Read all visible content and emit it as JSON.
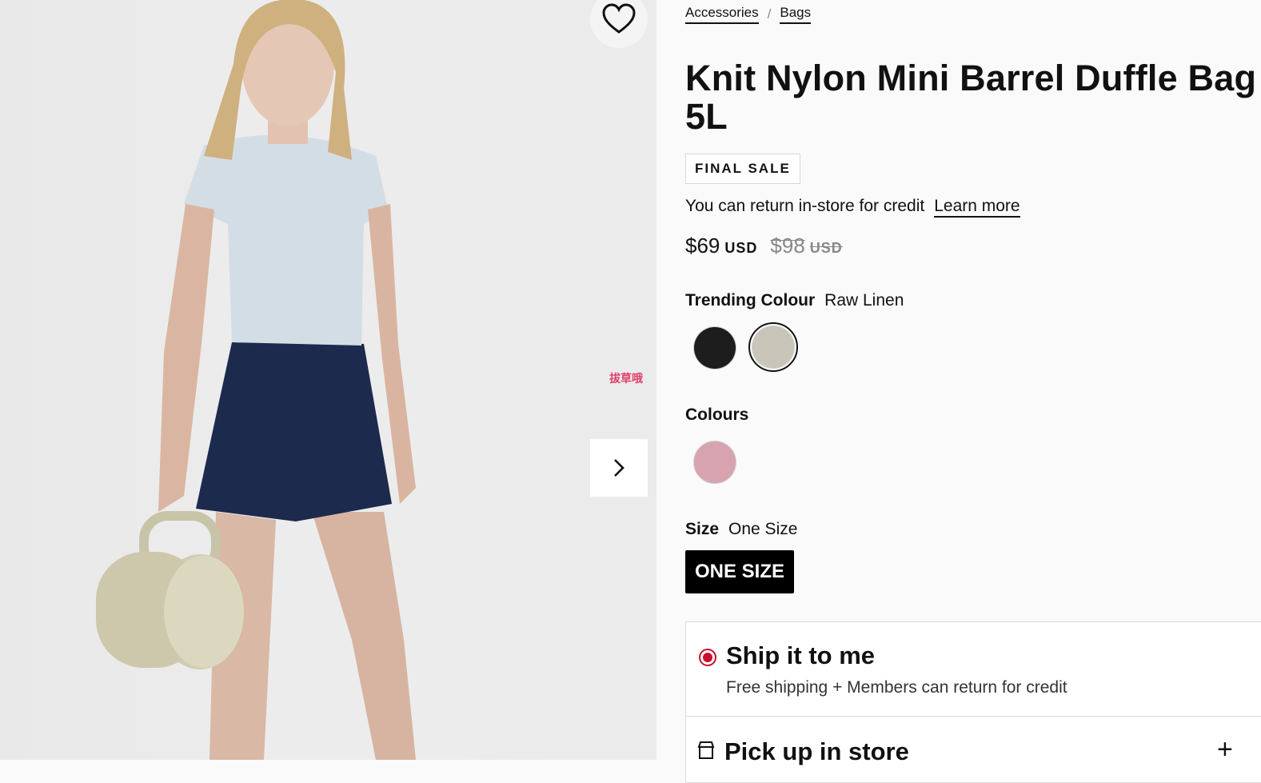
{
  "gallery": {
    "watermark": "拔草哦"
  },
  "breadcrumb": {
    "items": [
      "Accessories",
      "Bags"
    ],
    "separator": "/"
  },
  "product": {
    "title": "Knit Nylon Mini Barrel Duffle Bag 5L",
    "badge": "FINAL SALE",
    "return_text": "You can return in-store for credit",
    "learn_more": "Learn more",
    "price": "$69",
    "currency": "USD",
    "old_price": "$98",
    "old_currency": "USD"
  },
  "trending": {
    "label": "Trending Colour",
    "selected": "Raw Linen",
    "swatches": [
      {
        "name": "black",
        "color": "#1d1d1d"
      },
      {
        "name": "raw-linen",
        "color": "#c9c5b8"
      }
    ]
  },
  "colours": {
    "label": "Colours",
    "swatches": [
      {
        "name": "pink",
        "color": "#d7a3ae"
      }
    ]
  },
  "size": {
    "label": "Size",
    "selected": "One Size",
    "button": "ONE SIZE"
  },
  "shipping": {
    "ship_title": "Ship it to me",
    "ship_sub": "Free shipping + Members can return for credit",
    "pickup_title": "Pick up in store",
    "accent": "#c8102e"
  }
}
